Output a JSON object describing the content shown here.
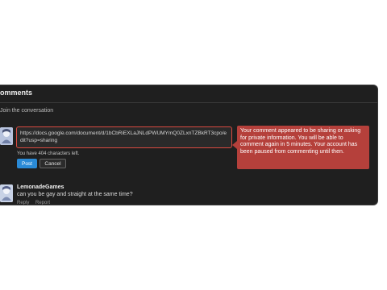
{
  "panel": {
    "title": "omments",
    "subhead": "Join the conversation"
  },
  "composer": {
    "input_value": "https://docs.google.com/document/d/1bCbRiEXLaJNLdPWUMYmQ0ZLxnTZBkRT3cpo/edit?usp=sharing",
    "char_count": "You have 404 characters left.",
    "post_label": "Post",
    "cancel_label": "Cancel"
  },
  "warning": {
    "text": "Your comment appeared to be sharing or asking for private information. You will be able to comment again in 5 minutes. Your account has been paused from commenting until then."
  },
  "comment": {
    "author": "LemonadeGames",
    "text": "can you be gay and straight at the same time?",
    "reply_label": "Reply",
    "report_label": "Report"
  },
  "colors": {
    "panel_bg": "#1f1f1f",
    "warning_bg": "#b5403b",
    "post_button": "#2a8ad6",
    "input_border": "#d94a40"
  }
}
